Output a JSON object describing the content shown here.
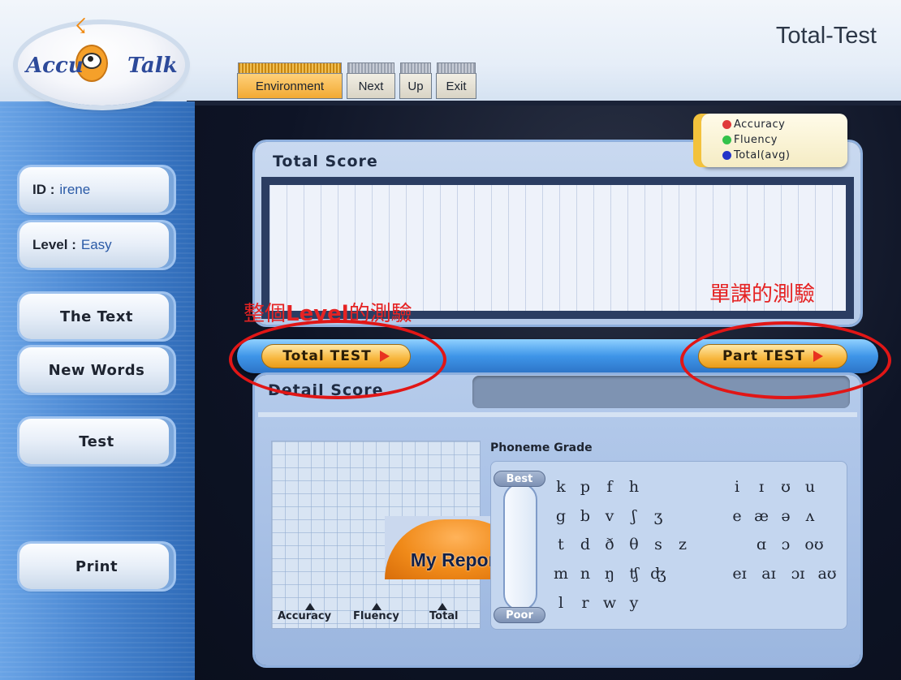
{
  "app": {
    "title": "Total-Test",
    "logo_text": "Accu Talk"
  },
  "menu": {
    "tabs": [
      "Environment",
      "Next",
      "Up",
      "Exit"
    ]
  },
  "sidebar": {
    "id_key": "ID :",
    "id_value": "irene",
    "level_key": "Level :",
    "level_value": "Easy",
    "buttons": [
      "The Text",
      "New Words",
      "Test",
      "Print"
    ]
  },
  "total_score": {
    "label": "Total Score"
  },
  "legend": {
    "items": [
      {
        "label": "Accuracy",
        "color": "#e03a3a"
      },
      {
        "label": "Fluency",
        "color": "#33c24a"
      },
      {
        "label": "Total(avg)",
        "color": "#2334c8"
      }
    ]
  },
  "test_bar": {
    "total_test": "Total TEST",
    "part_test": "Part TEST"
  },
  "annotations": {
    "left_prefix": "整個",
    "left_bold": "Level",
    "left_suffix": "的測驗",
    "right": "單課的測驗"
  },
  "detail": {
    "label": "Detail Score",
    "axes": [
      "Accuracy",
      "Fluency",
      "Total"
    ],
    "my_report": "My Report"
  },
  "phoneme": {
    "title": "Phoneme Grade",
    "best": "Best",
    "poor": "Poor",
    "consonants": [
      [
        "k",
        "p",
        "f",
        "h"
      ],
      [
        "g",
        "b",
        "v",
        "ʃ",
        "ʒ"
      ],
      [
        "t",
        "d",
        "ð",
        "θ",
        "s",
        "z"
      ],
      [
        "m",
        "n",
        "ŋ",
        "ʧ",
        "ʤ"
      ],
      [
        "l",
        "r",
        "w",
        "y"
      ]
    ],
    "vowels": [
      [
        "i",
        "ɪ",
        "ʊ",
        "u"
      ],
      [
        "e",
        "æ",
        "ə",
        "ʌ"
      ],
      [
        "ɑ",
        "ɔ",
        "oʊ"
      ],
      [
        "eɪ",
        "aɪ",
        "ɔɪ",
        "aʊ"
      ]
    ]
  }
}
